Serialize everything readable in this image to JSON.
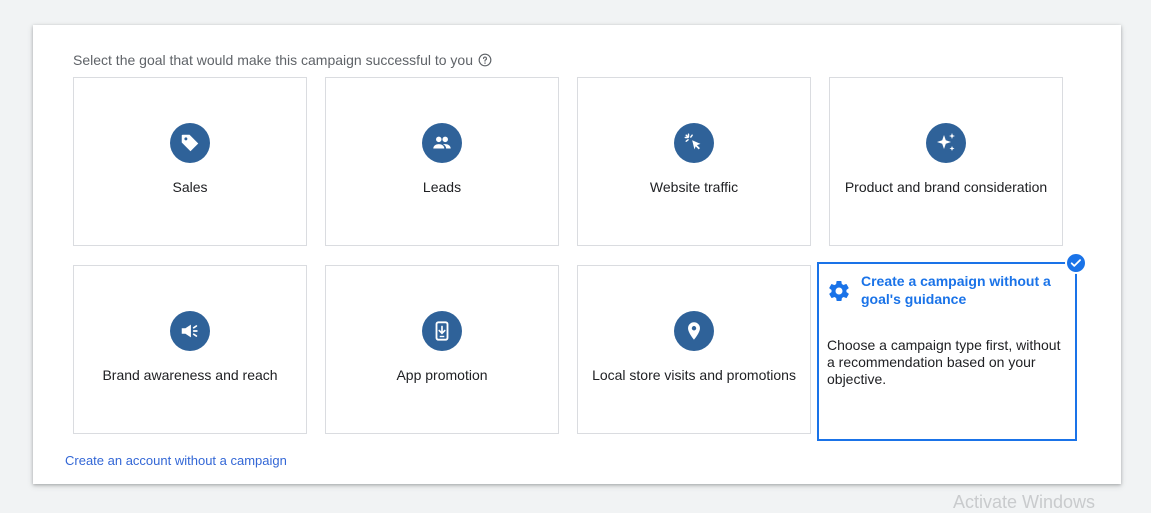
{
  "prompt": "Select the goal that would make this campaign successful to you",
  "goals": [
    {
      "label": "Sales",
      "icon": "tag-icon"
    },
    {
      "label": "Leads",
      "icon": "people-icon"
    },
    {
      "label": "Website traffic",
      "icon": "cursor-click-icon"
    },
    {
      "label": "Product and brand consideration",
      "icon": "sparkle-icon"
    },
    {
      "label": "Brand awareness and reach",
      "icon": "megaphone-icon"
    },
    {
      "label": "App promotion",
      "icon": "phone-download-icon"
    },
    {
      "label": "Local store visits and promotions",
      "icon": "location-pin-icon"
    }
  ],
  "selected_card": {
    "title": "Create a campaign without a goal's guidance",
    "description": "Choose a campaign type first, without a recommendation based on your objective.",
    "icon": "gear-icon",
    "selected": true
  },
  "footer_link": "Create an account without a campaign",
  "watermark": "Activate Windows",
  "colors": {
    "accent": "#1a73e8",
    "icon_bg": "#2f6299",
    "link": "#3367d6"
  }
}
